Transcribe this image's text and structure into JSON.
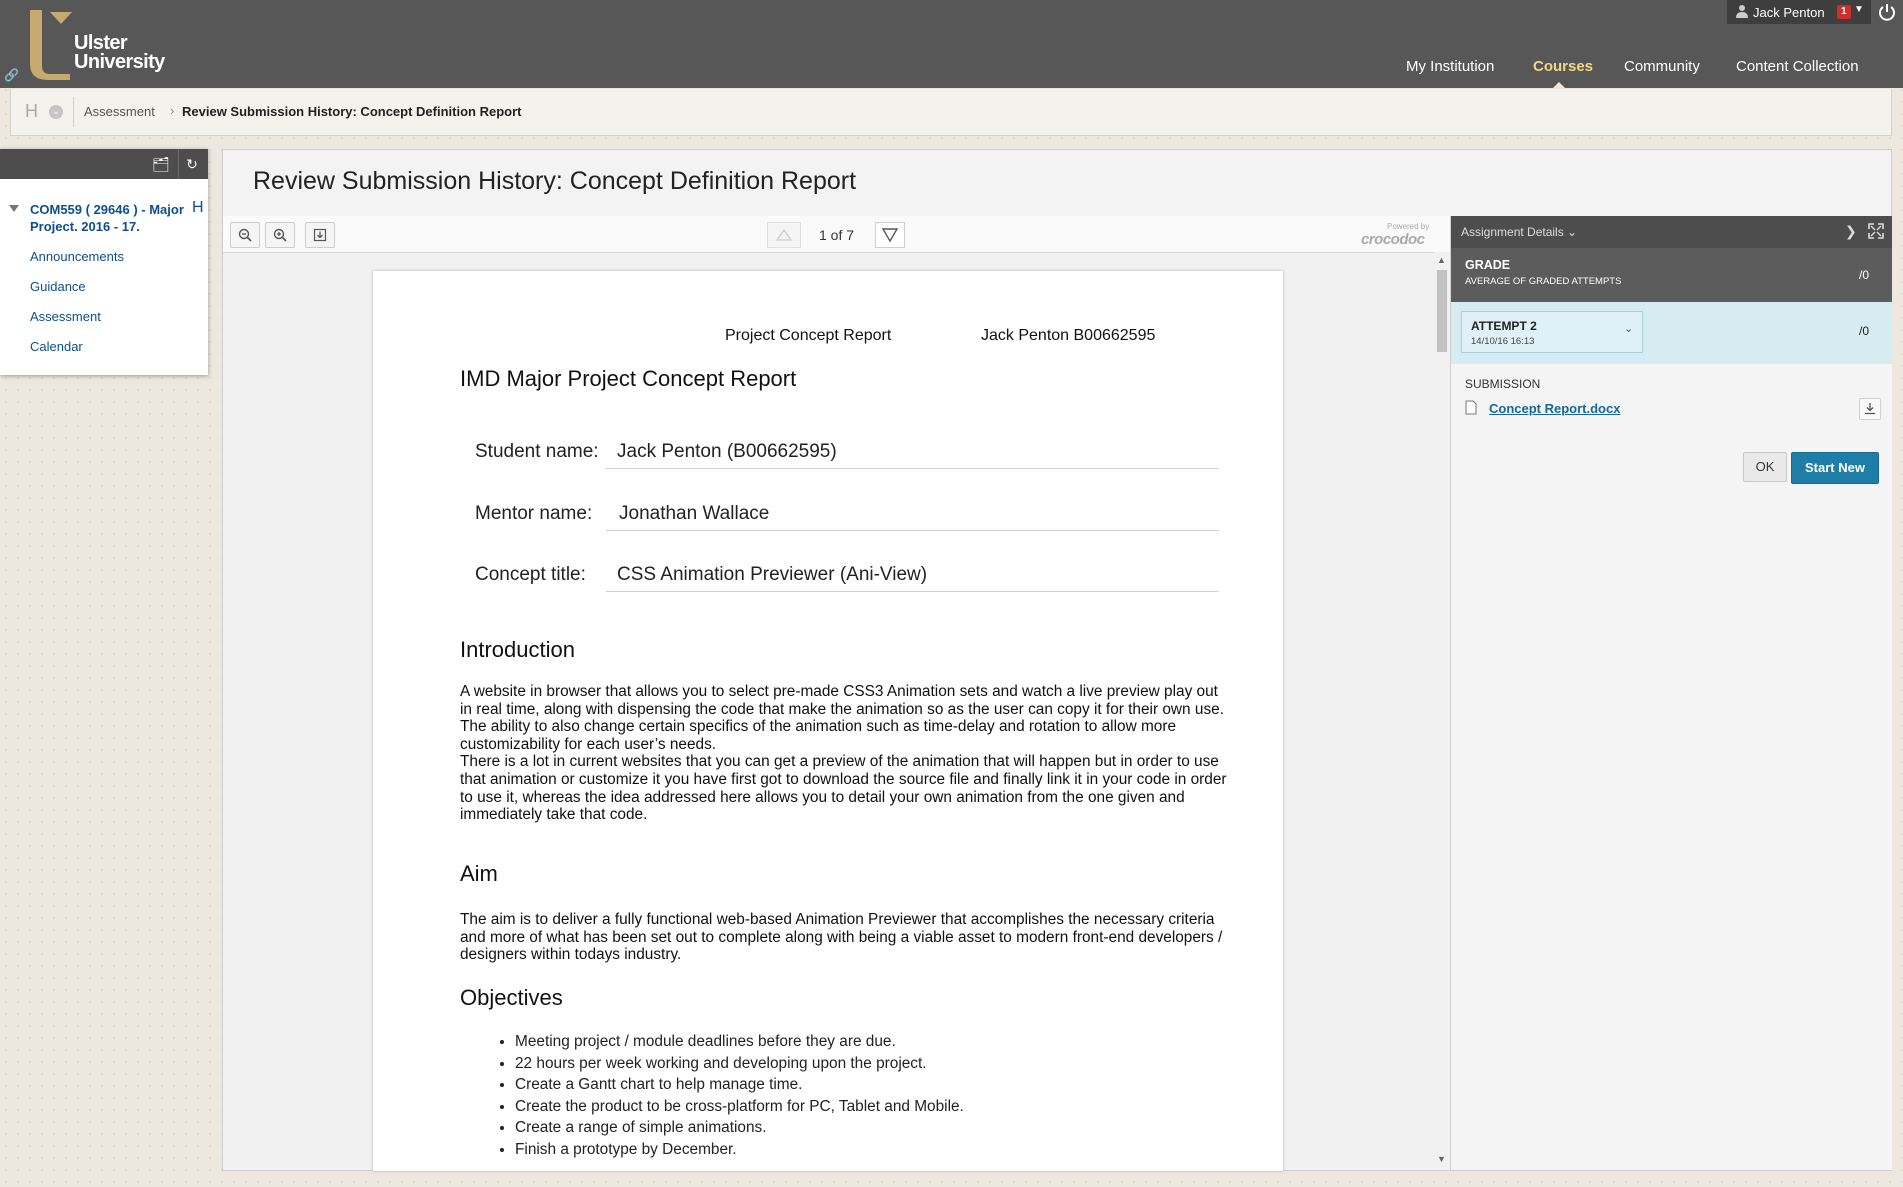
{
  "header": {
    "logo_line1": "Ulster",
    "logo_line2": "University",
    "user_name": "Jack Penton",
    "notification_count": "1",
    "nav": [
      "My Institution",
      "Courses",
      "Community",
      "Content Collection"
    ],
    "active_nav": "Courses",
    "accent_color": "#f2d784"
  },
  "breadcrumb": {
    "parent": "Assessment",
    "current": "Review Submission History: Concept Definition Report"
  },
  "course_menu": {
    "course_title": "COM559 ( 29646 ) - Major Project. 2016 - 17.",
    "h_label": "H",
    "items": [
      "Announcements",
      "Guidance",
      "Assessment",
      "Calendar"
    ]
  },
  "page_title": "Review Submission History: Concept Definition Report",
  "viewer": {
    "page_indicator": "1 of 7",
    "powered_by": "Powered by",
    "brand": "crocodoc",
    "document": {
      "header_left": "Project Concept Report",
      "header_right": "Jack Penton B00662595",
      "title": "IMD Major Project Concept Report",
      "fields": [
        {
          "label": "Student name:",
          "value": "Jack Penton (B00662595)"
        },
        {
          "label": "Mentor name:",
          "value": "Jonathan Wallace"
        },
        {
          "label": "Concept title:",
          "value": "CSS Animation Previewer (Ani-View)"
        }
      ],
      "intro_heading": "Introduction",
      "intro_paragraphs": [
        "A website in browser that allows you to select pre-made CSS3 Animation sets and watch a live preview play out in real time, along with dispensing the code that make the animation so as the user can copy it for their own use.",
        "The ability to also change certain specifics of the animation such as time-delay and rotation to allow more customizability for each user’s needs.",
        "There is a lot in current websites that you can get a preview of the animation that will happen but in order to use that animation or customize it you have first got to download the source file and finally link it in your code in order to use it, whereas the idea addressed here allows you to detail your own animation from the one given and immediately take that code."
      ],
      "aim_heading": "Aim",
      "aim_text": "The aim is to deliver a fully functional web-based Animation Previewer that accomplishes the necessary criteria and more of what has been set out to complete along with being a viable asset to modern front-end developers / designers within todays industry.",
      "objectives_heading": "Objectives",
      "objectives": [
        "Meeting project / module deadlines before they are due.",
        "22 hours per week working and developing upon the project.",
        "Create a Gantt chart to help manage time.",
        "Create the product to be cross-platform for PC, Tablet and Mobile.",
        "Create a range of simple animations.",
        "Finish a prototype by December."
      ]
    }
  },
  "sidebar": {
    "header": "Assignment Details",
    "grade_label": "GRADE",
    "grade_sub": "AVERAGE OF GRADED ATTEMPTS",
    "grade_value": "/0",
    "attempt_label": "ATTEMPT 2",
    "attempt_date": "14/10/16 16:13",
    "attempt_value": "/0",
    "submission_label": "SUBMISSION",
    "file_name": "Concept Report.docx",
    "ok_label": "OK",
    "start_new_label": "Start New",
    "primary_color": "#1f7ea8"
  }
}
